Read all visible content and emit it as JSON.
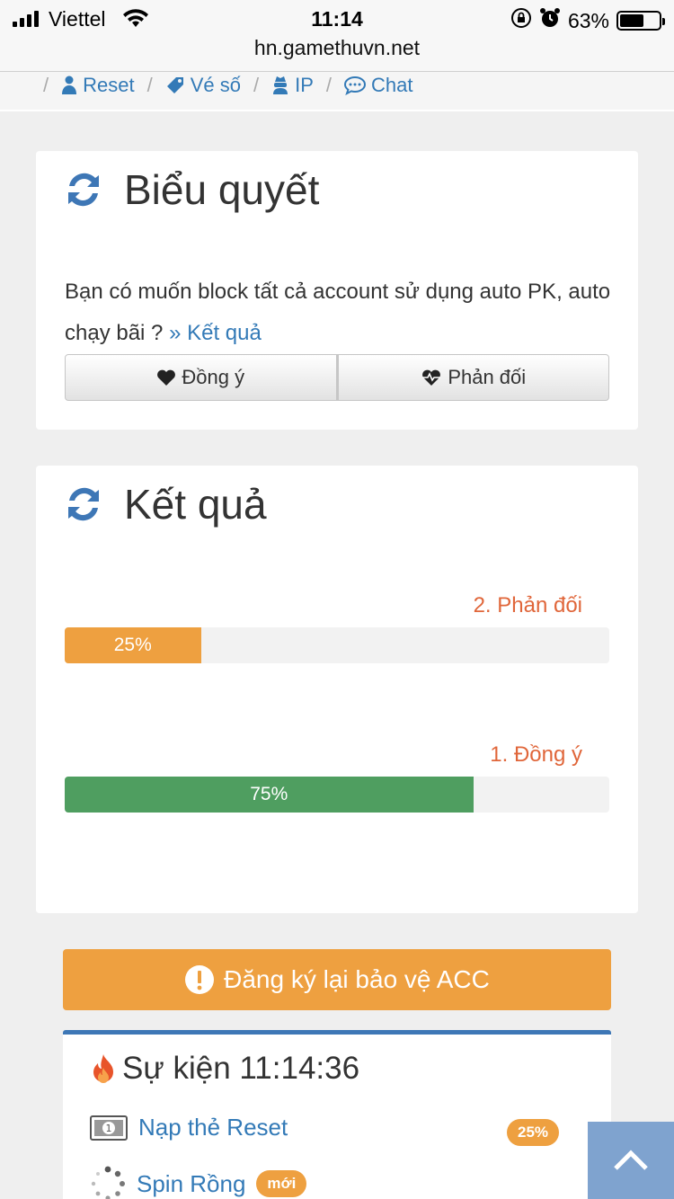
{
  "status": {
    "carrier": "Viettel",
    "time": "11:14",
    "battery": "63%",
    "battery_level": 0.63
  },
  "browser": {
    "url": "hn.gamethuvn.net"
  },
  "nav": [
    {
      "label": "Reset",
      "icon": "user-icon"
    },
    {
      "label": "Vé số",
      "icon": "ticket-icon"
    },
    {
      "label": "IP",
      "icon": "user-secret-icon"
    },
    {
      "label": "Chat",
      "icon": "comment-icon"
    }
  ],
  "poll": {
    "title": "Biểu quyết",
    "question": "Bạn có muốn block tất cả account sử dụng auto PK, auto chạy bãi ?",
    "result_link": "» Kết quả",
    "agree_label": "Đồng ý",
    "disagree_label": "Phản đối"
  },
  "results": {
    "title": "Kết quả",
    "items": [
      {
        "label": "2. Phản đối",
        "percent_text": "25%",
        "percent": 25,
        "color": "#eea040"
      },
      {
        "label": "1. Đồng ý",
        "percent_text": "75%",
        "percent": 75,
        "color": "#4f9e60"
      }
    ]
  },
  "acc_button": {
    "label": "Đăng ký lại bảo vệ ACC",
    "color": "#eea040"
  },
  "events": {
    "title": "Sự kiện 11:14:36",
    "items": [
      {
        "label": "Nạp thẻ Reset",
        "badge": "25%",
        "icon": "money-icon"
      },
      {
        "label": "Spin Rồng",
        "badge": "mới",
        "icon": "spinner-icon"
      }
    ]
  },
  "colors": {
    "accent": "#337ab7",
    "orange": "#eea040",
    "green": "#4f9e60",
    "label_orange": "#e0663a"
  }
}
